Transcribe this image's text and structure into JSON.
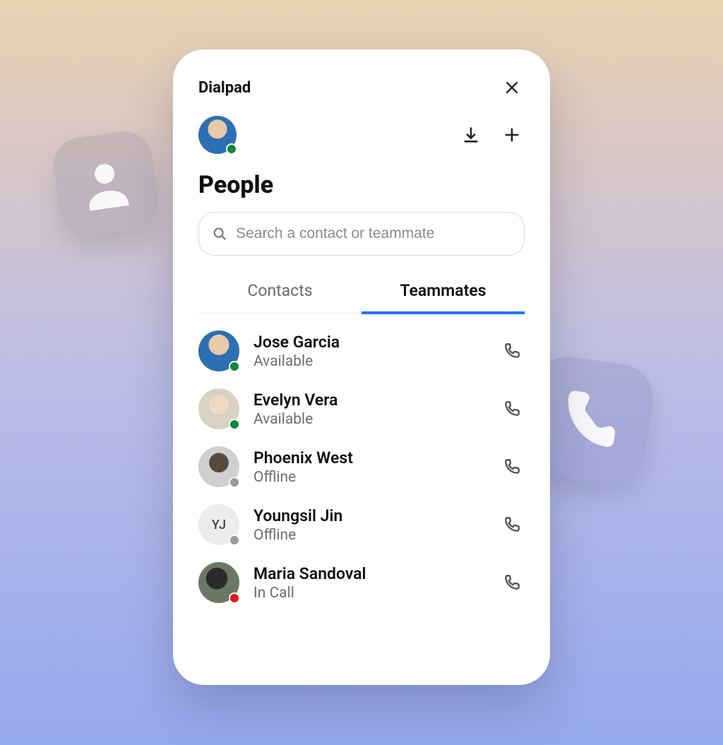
{
  "app": {
    "title": "Dialpad"
  },
  "page": {
    "title": "People"
  },
  "search": {
    "placeholder": "Search a contact or teammate",
    "value": ""
  },
  "tabs": {
    "contacts": "Contacts",
    "teammates": "Teammates",
    "active": "teammates"
  },
  "me": {
    "status": "available"
  },
  "teammates": [
    {
      "name": "Jose Garcia",
      "status_label": "Available",
      "status": "available",
      "initials": ""
    },
    {
      "name": "Evelyn Vera",
      "status_label": "Available",
      "status": "available",
      "initials": ""
    },
    {
      "name": "Phoenix West",
      "status_label": "Offline",
      "status": "offline",
      "initials": ""
    },
    {
      "name": "Youngsil Jin",
      "status_label": "Offline",
      "status": "offline",
      "initials": "YJ"
    },
    {
      "name": "Maria Sandoval",
      "status_label": "In Call",
      "status": "incall",
      "initials": ""
    }
  ],
  "icons": {
    "close": "close-icon",
    "download": "download-icon",
    "add": "plus-icon",
    "search": "search-icon",
    "phone": "phone-icon",
    "person": "person-icon"
  }
}
